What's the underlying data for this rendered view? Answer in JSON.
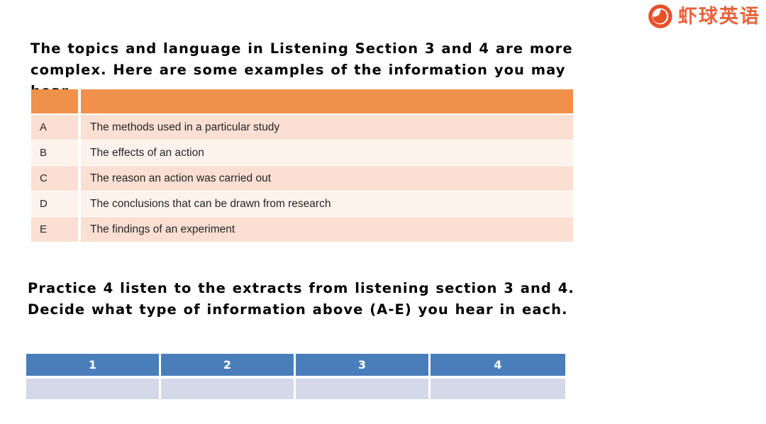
{
  "brand": {
    "logo_icon": "shrimp-circle-logo-icon",
    "name": "虾球英语",
    "color": "#e8623a",
    "mark_color": "#e8502a"
  },
  "content": {
    "lead_paragraph": "The topics and language in Listening Section 3 and 4 are more complex. Here are some examples of the information you may hear.",
    "instruction_paragraph": "Practice 4 listen to the extracts from listening section 3 and 4. Decide what type of information above (A-E) you hear in each."
  },
  "info_table": {
    "header": {
      "key": "",
      "value": ""
    },
    "header_color": "#f0914b",
    "row_color_odd": "#fadfd2",
    "row_color_even": "#fdf2ec",
    "rows": [
      {
        "key": "A",
        "value": "The methods used in a particular study"
      },
      {
        "key": "B",
        "value": "The effects of an action"
      },
      {
        "key": "C",
        "value": "The reason an action was carried out"
      },
      {
        "key": "D",
        "value": "The conclusions that can be drawn from research"
      },
      {
        "key": "E",
        "value": "The findings of an experiment"
      }
    ]
  },
  "answer_table": {
    "header_color": "#4a7ebb",
    "cell_color": "#d3d9e8",
    "headers": [
      "1",
      "2",
      "3",
      "4"
    ],
    "answers": [
      "",
      "",
      "",
      ""
    ]
  }
}
